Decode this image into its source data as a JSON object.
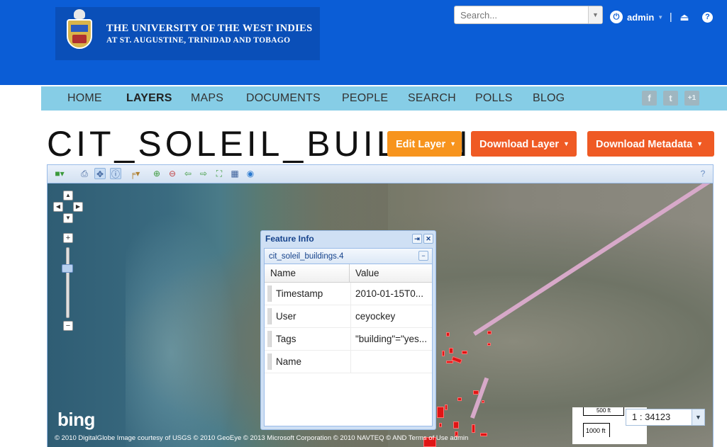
{
  "header": {
    "logo_line1": "THE UNIVERSITY OF THE WEST INDIES",
    "logo_line2": "AT ST. AUGUSTINE, TRINIDAD AND TOBAGO",
    "search_placeholder": "Search...",
    "user_name": "admin",
    "separator": "|",
    "help_label": "?"
  },
  "nav": {
    "items": [
      {
        "label": "HOME"
      },
      {
        "label": "LAYERS"
      },
      {
        "label": "MAPS"
      },
      {
        "label": "DOCUMENTS"
      },
      {
        "label": "PEOPLE"
      },
      {
        "label": "SEARCH"
      },
      {
        "label": "POLLS"
      },
      {
        "label": "BLOG"
      }
    ],
    "active": "LAYERS",
    "social": [
      "f",
      "t",
      "+1"
    ]
  },
  "page": {
    "title": "CIT_SOLEIL_BUILDINGS",
    "buttons": {
      "edit": "Edit Layer",
      "download": "Download Layer",
      "metadata": "Download Metadata"
    }
  },
  "map": {
    "provider_logo": "bing",
    "attribution": "© 2010 DigitalGlobe Image courtesy of USGS © 2010 GeoEye © 2013 Microsoft Corporation © 2010 NAVTEQ © AND  Terms of Use  admin",
    "scale_top": "500 ft",
    "scale_bottom": "1000 ft",
    "scale_value": "1 : 34123"
  },
  "feature_info": {
    "title": "Feature Info",
    "layer_item": "cit_soleil_buildings.4",
    "columns": {
      "name": "Name",
      "value": "Value"
    },
    "rows": [
      {
        "name": "Timestamp",
        "value": "2010-01-15T0..."
      },
      {
        "name": "User",
        "value": "ceyockey"
      },
      {
        "name": "Tags",
        "value": "\"building\"=\"yes..."
      },
      {
        "name": "Name",
        "value": ""
      }
    ]
  },
  "colors": {
    "header_blue": "#0b5dd6",
    "nav_bar": "#86cde6",
    "edit_button": "#f7941d",
    "download_button": "#ef5a24",
    "building_red": "#e01515"
  }
}
